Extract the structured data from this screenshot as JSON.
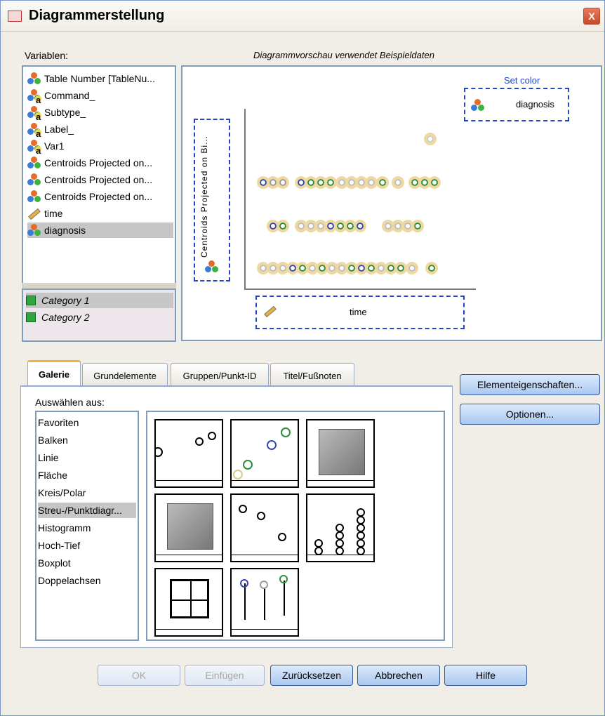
{
  "window": {
    "title": "Diagrammerstellung",
    "close": "X"
  },
  "variables_label": "Variablen:",
  "preview_caption": "Diagrammvorschau verwendet Beispieldaten",
  "variables": [
    {
      "label": "Table Number [TableNu...",
      "icon": "nominal-icon"
    },
    {
      "label": "Command_",
      "icon": "string-nominal-icon"
    },
    {
      "label": "Subtype_",
      "icon": "string-nominal-icon"
    },
    {
      "label": "Label_",
      "icon": "string-nominal-icon"
    },
    {
      "label": "Var1",
      "icon": "string-nominal-icon"
    },
    {
      "label": "Centroids Projected on...",
      "icon": "nominal-icon"
    },
    {
      "label": "Centroids Projected on...",
      "icon": "nominal-icon"
    },
    {
      "label": "Centroids Projected on...",
      "icon": "nominal-icon"
    },
    {
      "label": "time",
      "icon": "scale-ruler-icon"
    },
    {
      "label": "diagnosis",
      "icon": "nominal-icon",
      "selected": true
    }
  ],
  "categories": [
    "Category 1",
    "Category 2"
  ],
  "preview": {
    "set_color_label": "Set color",
    "color_field": "diagnosis",
    "y_axis_field": "Centroids Projected on Bi...",
    "x_axis_field": "time"
  },
  "tabs": [
    "Galerie",
    "Grundelemente",
    "Gruppen/Punkt-ID",
    "Titel/Fußnoten"
  ],
  "choose_from_label": "Auswählen aus:",
  "chart_types": [
    "Favoriten",
    "Balken",
    "Linie",
    "Fläche",
    "Kreis/Polar",
    "Streu-/Punktdiagr...",
    "Histogramm",
    "Hoch-Tief",
    "Boxplot",
    "Doppelachsen"
  ],
  "selected_chart_type": "Streu-/Punktdiagr...",
  "side_buttons": {
    "element_properties": "Elementeigenschaften...",
    "options": "Optionen..."
  },
  "buttons": {
    "ok": "OK",
    "paste": "Einfügen",
    "reset": "Zurücksetzen",
    "cancel": "Abbrechen",
    "help": "Hilfe"
  },
  "colors": {
    "accent_blue": "#2244cc",
    "tab_orange": "#f3b23a",
    "circle_tan": "#efd9a0",
    "circle_green": "#2e8b3a",
    "circle_blue": "#3445b0"
  }
}
